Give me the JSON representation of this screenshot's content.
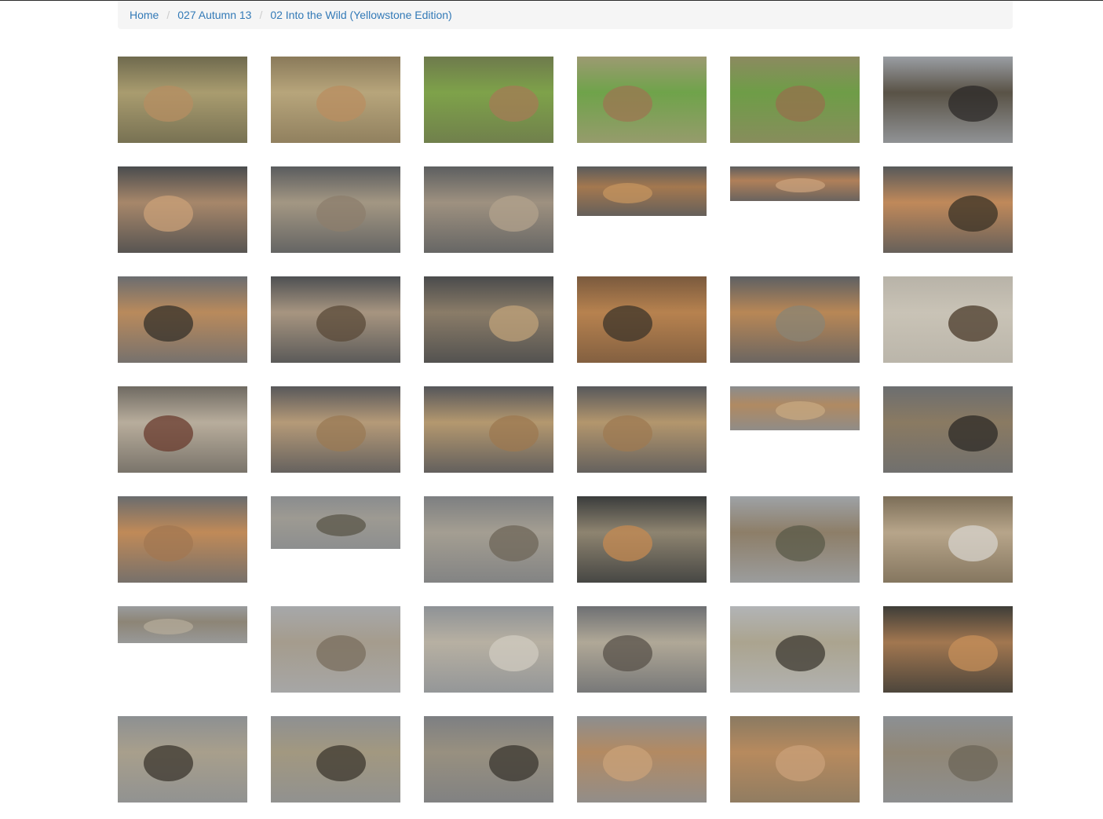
{
  "breadcrumb": {
    "home": "Home",
    "album": "027 Autumn 13",
    "gallery": "02 Into the Wild (Yellowstone Edition)"
  },
  "gallery": {
    "photos": [
      {
        "name": "elk-standing-sagebrush",
        "sky": "#6f6a4e",
        "ground": "#a99c6f",
        "accent": "#b58e62"
      },
      {
        "name": "elk-in-front-of-building",
        "sky": "#8a7a5a",
        "ground": "#b7a57b",
        "accent": "#b98e60"
      },
      {
        "name": "elk-on-lawn-building",
        "sky": "#6e7a4c",
        "ground": "#7ea24a",
        "accent": "#a47b56"
      },
      {
        "name": "elk-grazing-lawn",
        "sky": "#9d9a72",
        "ground": "#6fa34a",
        "accent": "#9c7552"
      },
      {
        "name": "elk-grazing-lawn-2",
        "sky": "#8c8a60",
        "ground": "#6e9d47",
        "accent": "#96704c"
      },
      {
        "name": "picnic-table-cloudy",
        "sky": "#9a9ea3",
        "ground": "#595246",
        "accent": "#2c2a28"
      },
      {
        "name": "terraces-landscape",
        "sky": "#4a4c4e",
        "ground": "#a7876a",
        "accent": "#c9a078"
      },
      {
        "name": "terraces-steam",
        "sky": "#5a5c5e",
        "ground": "#a39783",
        "accent": "#8c7e6c"
      },
      {
        "name": "liberty-cap-boardwalk",
        "sky": "#5d5f60",
        "ground": "#9e9180",
        "accent": "#b2a18c"
      },
      {
        "name": "orange-hillside-wide",
        "sky": "#5a5b5c",
        "ground": "#a4784f",
        "accent": "#c4945f"
      },
      {
        "name": "orange-terrace-panorama",
        "sky": "#5d5e5f",
        "ground": "#b08059",
        "accent": "#c9a27c"
      },
      {
        "name": "orange-hill-dead-tree",
        "sky": "#57595a",
        "ground": "#c0895a",
        "accent": "#3a3226"
      },
      {
        "name": "terrace-with-trees",
        "sky": "#6b6d70",
        "ground": "#b98a5c",
        "accent": "#34302a"
      },
      {
        "name": "dark-rock-boardwalk",
        "sky": "#4e5052",
        "ground": "#a79580",
        "accent": "#5a4a38"
      },
      {
        "name": "steam-dark-sky",
        "sky": "#4a4b4c",
        "ground": "#8a7c68",
        "accent": "#bfa27a"
      },
      {
        "name": "orange-cliff-face",
        "sky": "#7a5a3e",
        "ground": "#b7824f",
        "accent": "#3c342a"
      },
      {
        "name": "orange-slope-trees",
        "sky": "#5e6063",
        "ground": "#b88756",
        "accent": "#8a8474"
      },
      {
        "name": "sign-on-white-ground",
        "sky": "#b8b3a8",
        "ground": "#c9c3b6",
        "accent": "#4a3a2a"
      },
      {
        "name": "person-portrait-terrace",
        "sky": "#6f6a62",
        "ground": "#b8ad9c",
        "accent": "#6a3b2e"
      },
      {
        "name": "terrace-cascade",
        "sky": "#58585a",
        "ground": "#b59a78",
        "accent": "#9a7a54"
      },
      {
        "name": "terrace-cascade-2",
        "sky": "#55565a",
        "ground": "#b4986f",
        "accent": "#9c7850"
      },
      {
        "name": "terrace-cascade-3",
        "sky": "#57585b",
        "ground": "#b3966d",
        "accent": "#9d7a52"
      },
      {
        "name": "terrace-cascade-wide",
        "sky": "#8a8c8e",
        "ground": "#b08a62",
        "accent": "#c7a882"
      },
      {
        "name": "dead-trees-steam",
        "sky": "#6c6e70",
        "ground": "#8a7a62",
        "accent": "#2c2a26"
      },
      {
        "name": "orange-mound-trees",
        "sky": "#6a6c6e",
        "ground": "#c08a58",
        "accent": "#a27752"
      },
      {
        "name": "boardwalk-panorama",
        "sky": "#8a8c8e",
        "ground": "#9d9a92",
        "accent": "#5a5648"
      },
      {
        "name": "boardwalk-terrace",
        "sky": "#7d7f81",
        "ground": "#a49e92",
        "accent": "#6e6658"
      },
      {
        "name": "steam-vent-dark",
        "sky": "#3a3c3c",
        "ground": "#8e8470",
        "accent": "#c48a52"
      },
      {
        "name": "dry-terrace-trees",
        "sky": "#9ea2a6",
        "ground": "#8d7e68",
        "accent": "#5a5a48"
      },
      {
        "name": "fallen-log",
        "sky": "#7c6e58",
        "ground": "#b7a58a",
        "accent": "#d7d3cc"
      },
      {
        "name": "flat-valley-panorama",
        "sky": "#9a9c9e",
        "ground": "#8d8576",
        "accent": "#b4ab9a"
      },
      {
        "name": "grey-terrace-cliffs",
        "sky": "#a6a8aa",
        "ground": "#a59c8d",
        "accent": "#7a6e5e"
      },
      {
        "name": "white-terrace-mist",
        "sky": "#8e9296",
        "ground": "#b7b0a2",
        "accent": "#d0cbc0"
      },
      {
        "name": "grey-flats-steam",
        "sky": "#6e7073",
        "ground": "#b0a897",
        "accent": "#58524a"
      },
      {
        "name": "dead-trees-white-ground",
        "sky": "#b2b4b6",
        "ground": "#aba48f",
        "accent": "#3e3a32"
      },
      {
        "name": "orange-steam-pool",
        "sky": "#3e3d38",
        "ground": "#a27750",
        "accent": "#c68f5a"
      },
      {
        "name": "dead-trees-steam-flats",
        "sky": "#8d9092",
        "ground": "#a89f8c",
        "accent": "#3b362e"
      },
      {
        "name": "dead-trees-valley",
        "sky": "#8e9092",
        "ground": "#a29880",
        "accent": "#3c372e"
      },
      {
        "name": "steam-dead-trees",
        "sky": "#7d7f82",
        "ground": "#989080",
        "accent": "#3a362f"
      },
      {
        "name": "orange-hill-steam",
        "sky": "#8c8e90",
        "ground": "#b38a62",
        "accent": "#c9a179"
      },
      {
        "name": "orange-slope-close",
        "sky": "#8a7a62",
        "ground": "#b78a5e",
        "accent": "#c9a07a"
      },
      {
        "name": "valley-grey-terrace",
        "sky": "#8c9094",
        "ground": "#918776",
        "accent": "#6c6658"
      }
    ]
  }
}
